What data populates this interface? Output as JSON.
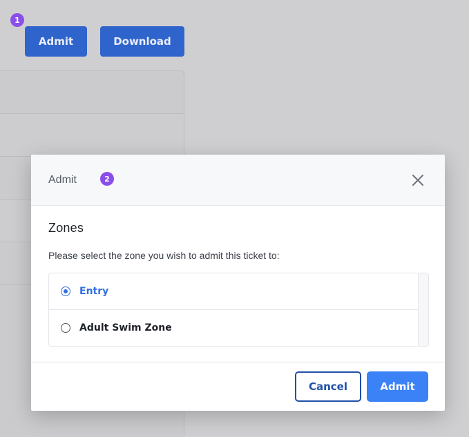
{
  "background": {
    "step_badge": "1",
    "admit_button": "Admit",
    "download_button": "Download"
  },
  "modal": {
    "title": "Admit",
    "step_badge": "2",
    "close_icon": "close-icon",
    "section_title": "Zones",
    "instructions": "Please select the zone you wish to admit this ticket to:",
    "zones": [
      {
        "label": "Entry",
        "selected": true
      },
      {
        "label": "Adult Swim Zone",
        "selected": false
      }
    ],
    "cancel_label": "Cancel",
    "admit_label": "Admit"
  },
  "colors": {
    "accent": "#3b82f6",
    "badge": "#8a4fe8",
    "selected_text": "#2f6fe0"
  }
}
